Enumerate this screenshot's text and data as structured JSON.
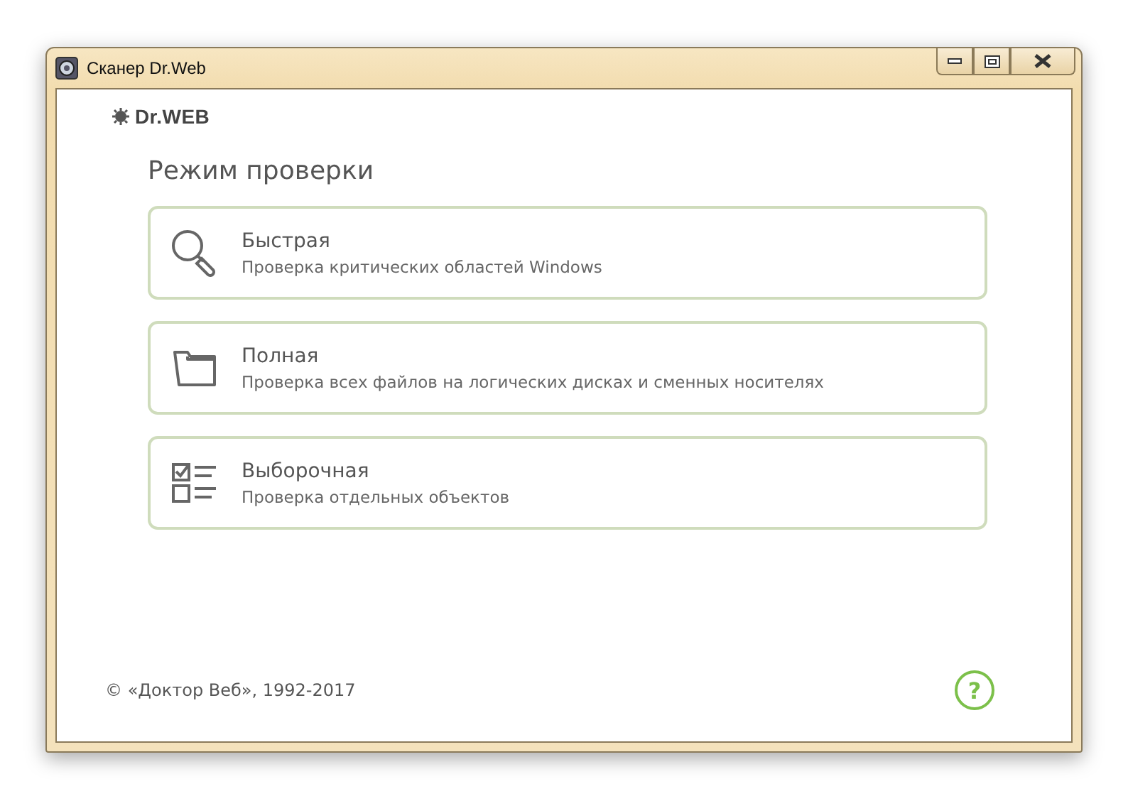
{
  "window": {
    "title": "Сканер Dr.Web"
  },
  "logo": {
    "text": "Dr.WEB"
  },
  "heading": "Режим проверки",
  "options": [
    {
      "kind": "search",
      "title": "Быстрая",
      "description": "Проверка критических областей Windows"
    },
    {
      "kind": "folder",
      "title": "Полная",
      "description": "Проверка всех файлов на логических дисках и сменных носителях"
    },
    {
      "kind": "checklist",
      "title": "Выборочная",
      "description": "Проверка отдельных объектов"
    }
  ],
  "footer": {
    "copyright": "© «Доктор Веб», 1992-2017",
    "help": "?"
  }
}
